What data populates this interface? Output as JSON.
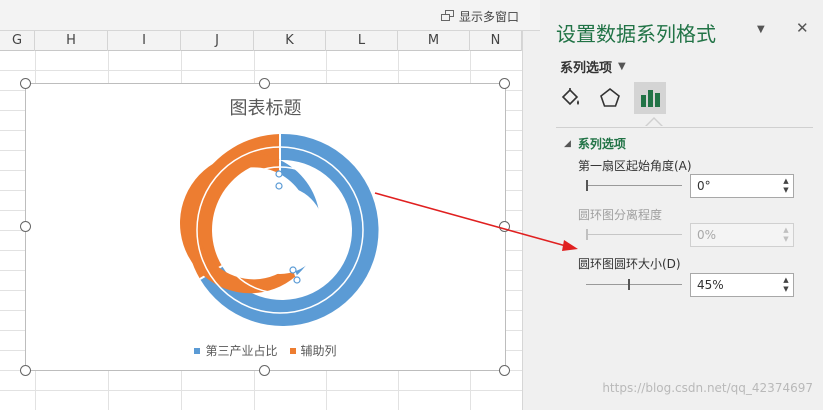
{
  "toolbar": {
    "show_multi_window": "显示多窗口"
  },
  "columns": [
    "G",
    "H",
    "I",
    "J",
    "K",
    "L",
    "M",
    "N"
  ],
  "chart": {
    "title": "图表标题",
    "legend": [
      {
        "name": "第三产业占比",
        "color": "#5b9bd5"
      },
      {
        "name": "辅助列",
        "color": "#ed7d31"
      }
    ]
  },
  "chart_data": {
    "type": "pie",
    "title": "图表标题",
    "hole_size_percent": 45,
    "legend_position": "bottom",
    "series": [
      {
        "name": "第三产业占比",
        "color": "#5b9bd5"
      },
      {
        "name": "辅助列",
        "color": "#ed7d31"
      }
    ]
  },
  "pane": {
    "title": "设置数据系列格式",
    "menu_label": "系列选项",
    "section_title": "系列选项",
    "options": [
      {
        "label": "第一扇区起始角度(A)",
        "value": "0°",
        "disabled": false,
        "slider": 0
      },
      {
        "label": "圆环图分离程度",
        "value": "0%",
        "disabled": true,
        "slider": 0
      },
      {
        "label": "圆环图圆环大小(D)",
        "value": "45%",
        "disabled": false,
        "slider": 0.45
      }
    ]
  },
  "watermark": "https://blog.csdn.net/qq_42374697"
}
